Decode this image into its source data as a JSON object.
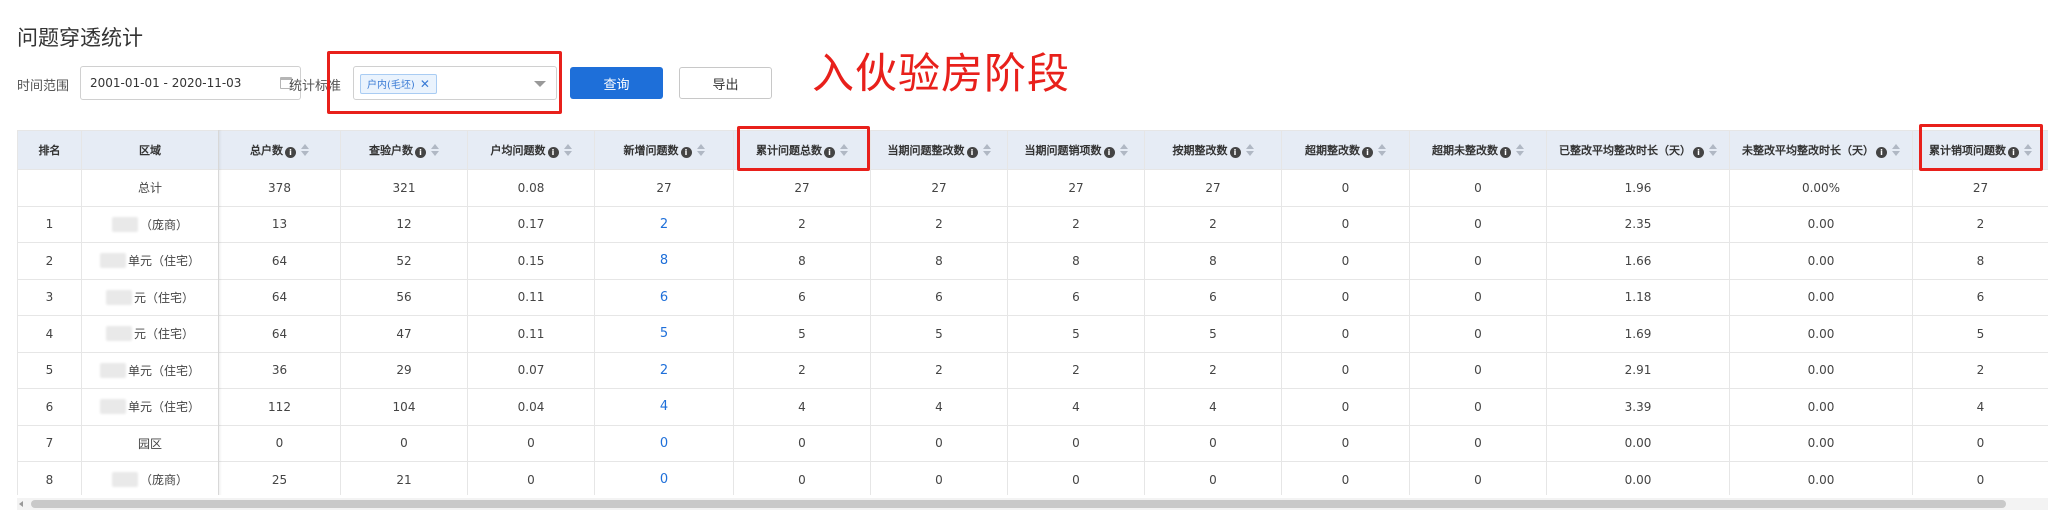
{
  "page": {
    "title": "问题穿透统计"
  },
  "filters": {
    "time_label": "时间范围",
    "date_range": "2001-01-01 - 2020-11-03",
    "standard_label": "统计标准",
    "selected_tag": "户内(毛坯)",
    "query_label": "查询",
    "export_label": "导出"
  },
  "annotation": "入伙验房阶段",
  "table": {
    "columns": [
      {
        "label": "排名",
        "info": false,
        "sort": false
      },
      {
        "label": "区域",
        "info": false,
        "sort": false
      },
      {
        "label": "总户数",
        "info": true,
        "sort": true
      },
      {
        "label": "查验户数",
        "info": true,
        "sort": true
      },
      {
        "label": "户均问题数",
        "info": true,
        "sort": true
      },
      {
        "label": "新增问题数",
        "info": true,
        "sort": true
      },
      {
        "label": "累计问题总数",
        "info": true,
        "sort": true
      },
      {
        "label": "当期问题整改数",
        "info": true,
        "sort": true
      },
      {
        "label": "当期问题销项数",
        "info": true,
        "sort": true
      },
      {
        "label": "按期整改数",
        "info": true,
        "sort": true
      },
      {
        "label": "超期整改数",
        "info": true,
        "sort": true
      },
      {
        "label": "超期未整改数",
        "info": true,
        "sort": true
      },
      {
        "label": "已整改平均整改时长（天）",
        "info": true,
        "sort": true
      },
      {
        "label": "未整改平均整改时长（天）",
        "info": true,
        "sort": true
      },
      {
        "label": "累计销项问题数",
        "info": true,
        "sort": true
      }
    ],
    "total_row": [
      "",
      "总计",
      "378",
      "321",
      "0.08",
      "27",
      "27",
      "27",
      "27",
      "27",
      "0",
      "0",
      "1.96",
      "0.00%",
      "27"
    ],
    "rows": [
      [
        "1",
        "（庞商）",
        "13",
        "12",
        "0.17",
        "2",
        "2",
        "2",
        "2",
        "2",
        "0",
        "0",
        "2.35",
        "0.00",
        "2"
      ],
      [
        "2",
        "单元（住宅）",
        "64",
        "52",
        "0.15",
        "8",
        "8",
        "8",
        "8",
        "8",
        "0",
        "0",
        "1.66",
        "0.00",
        "8"
      ],
      [
        "3",
        "元（住宅）",
        "64",
        "56",
        "0.11",
        "6",
        "6",
        "6",
        "6",
        "6",
        "0",
        "0",
        "1.18",
        "0.00",
        "6"
      ],
      [
        "4",
        "元（住宅）",
        "64",
        "47",
        "0.11",
        "5",
        "5",
        "5",
        "5",
        "5",
        "0",
        "0",
        "1.69",
        "0.00",
        "5"
      ],
      [
        "5",
        "单元（住宅）",
        "36",
        "29",
        "0.07",
        "2",
        "2",
        "2",
        "2",
        "2",
        "0",
        "0",
        "2.91",
        "0.00",
        "2"
      ],
      [
        "6",
        "单元（住宅）",
        "112",
        "104",
        "0.04",
        "4",
        "4",
        "4",
        "4",
        "4",
        "0",
        "0",
        "3.39",
        "0.00",
        "4"
      ],
      [
        "7",
        "园区",
        "0",
        "0",
        "0",
        "0",
        "0",
        "0",
        "0",
        "0",
        "0",
        "0",
        "0.00",
        "0.00",
        "0"
      ],
      [
        "8",
        "（庞商）",
        "25",
        "21",
        "0",
        "0",
        "0",
        "0",
        "0",
        "0",
        "0",
        "0",
        "0.00",
        "0.00",
        "0"
      ]
    ],
    "blurred_region_rows": [
      0,
      1,
      2,
      3,
      4,
      5,
      7
    ]
  },
  "icons": {
    "calendar": "calendar-icon",
    "dropdown": "chevron-down-icon",
    "info": "info-icon",
    "sort": "sort-icon",
    "tag_close": "close-icon"
  },
  "colors": {
    "primary": "#1e6fd9",
    "annotation_red": "#e8201b",
    "header_bg": "#e6ecf5"
  }
}
